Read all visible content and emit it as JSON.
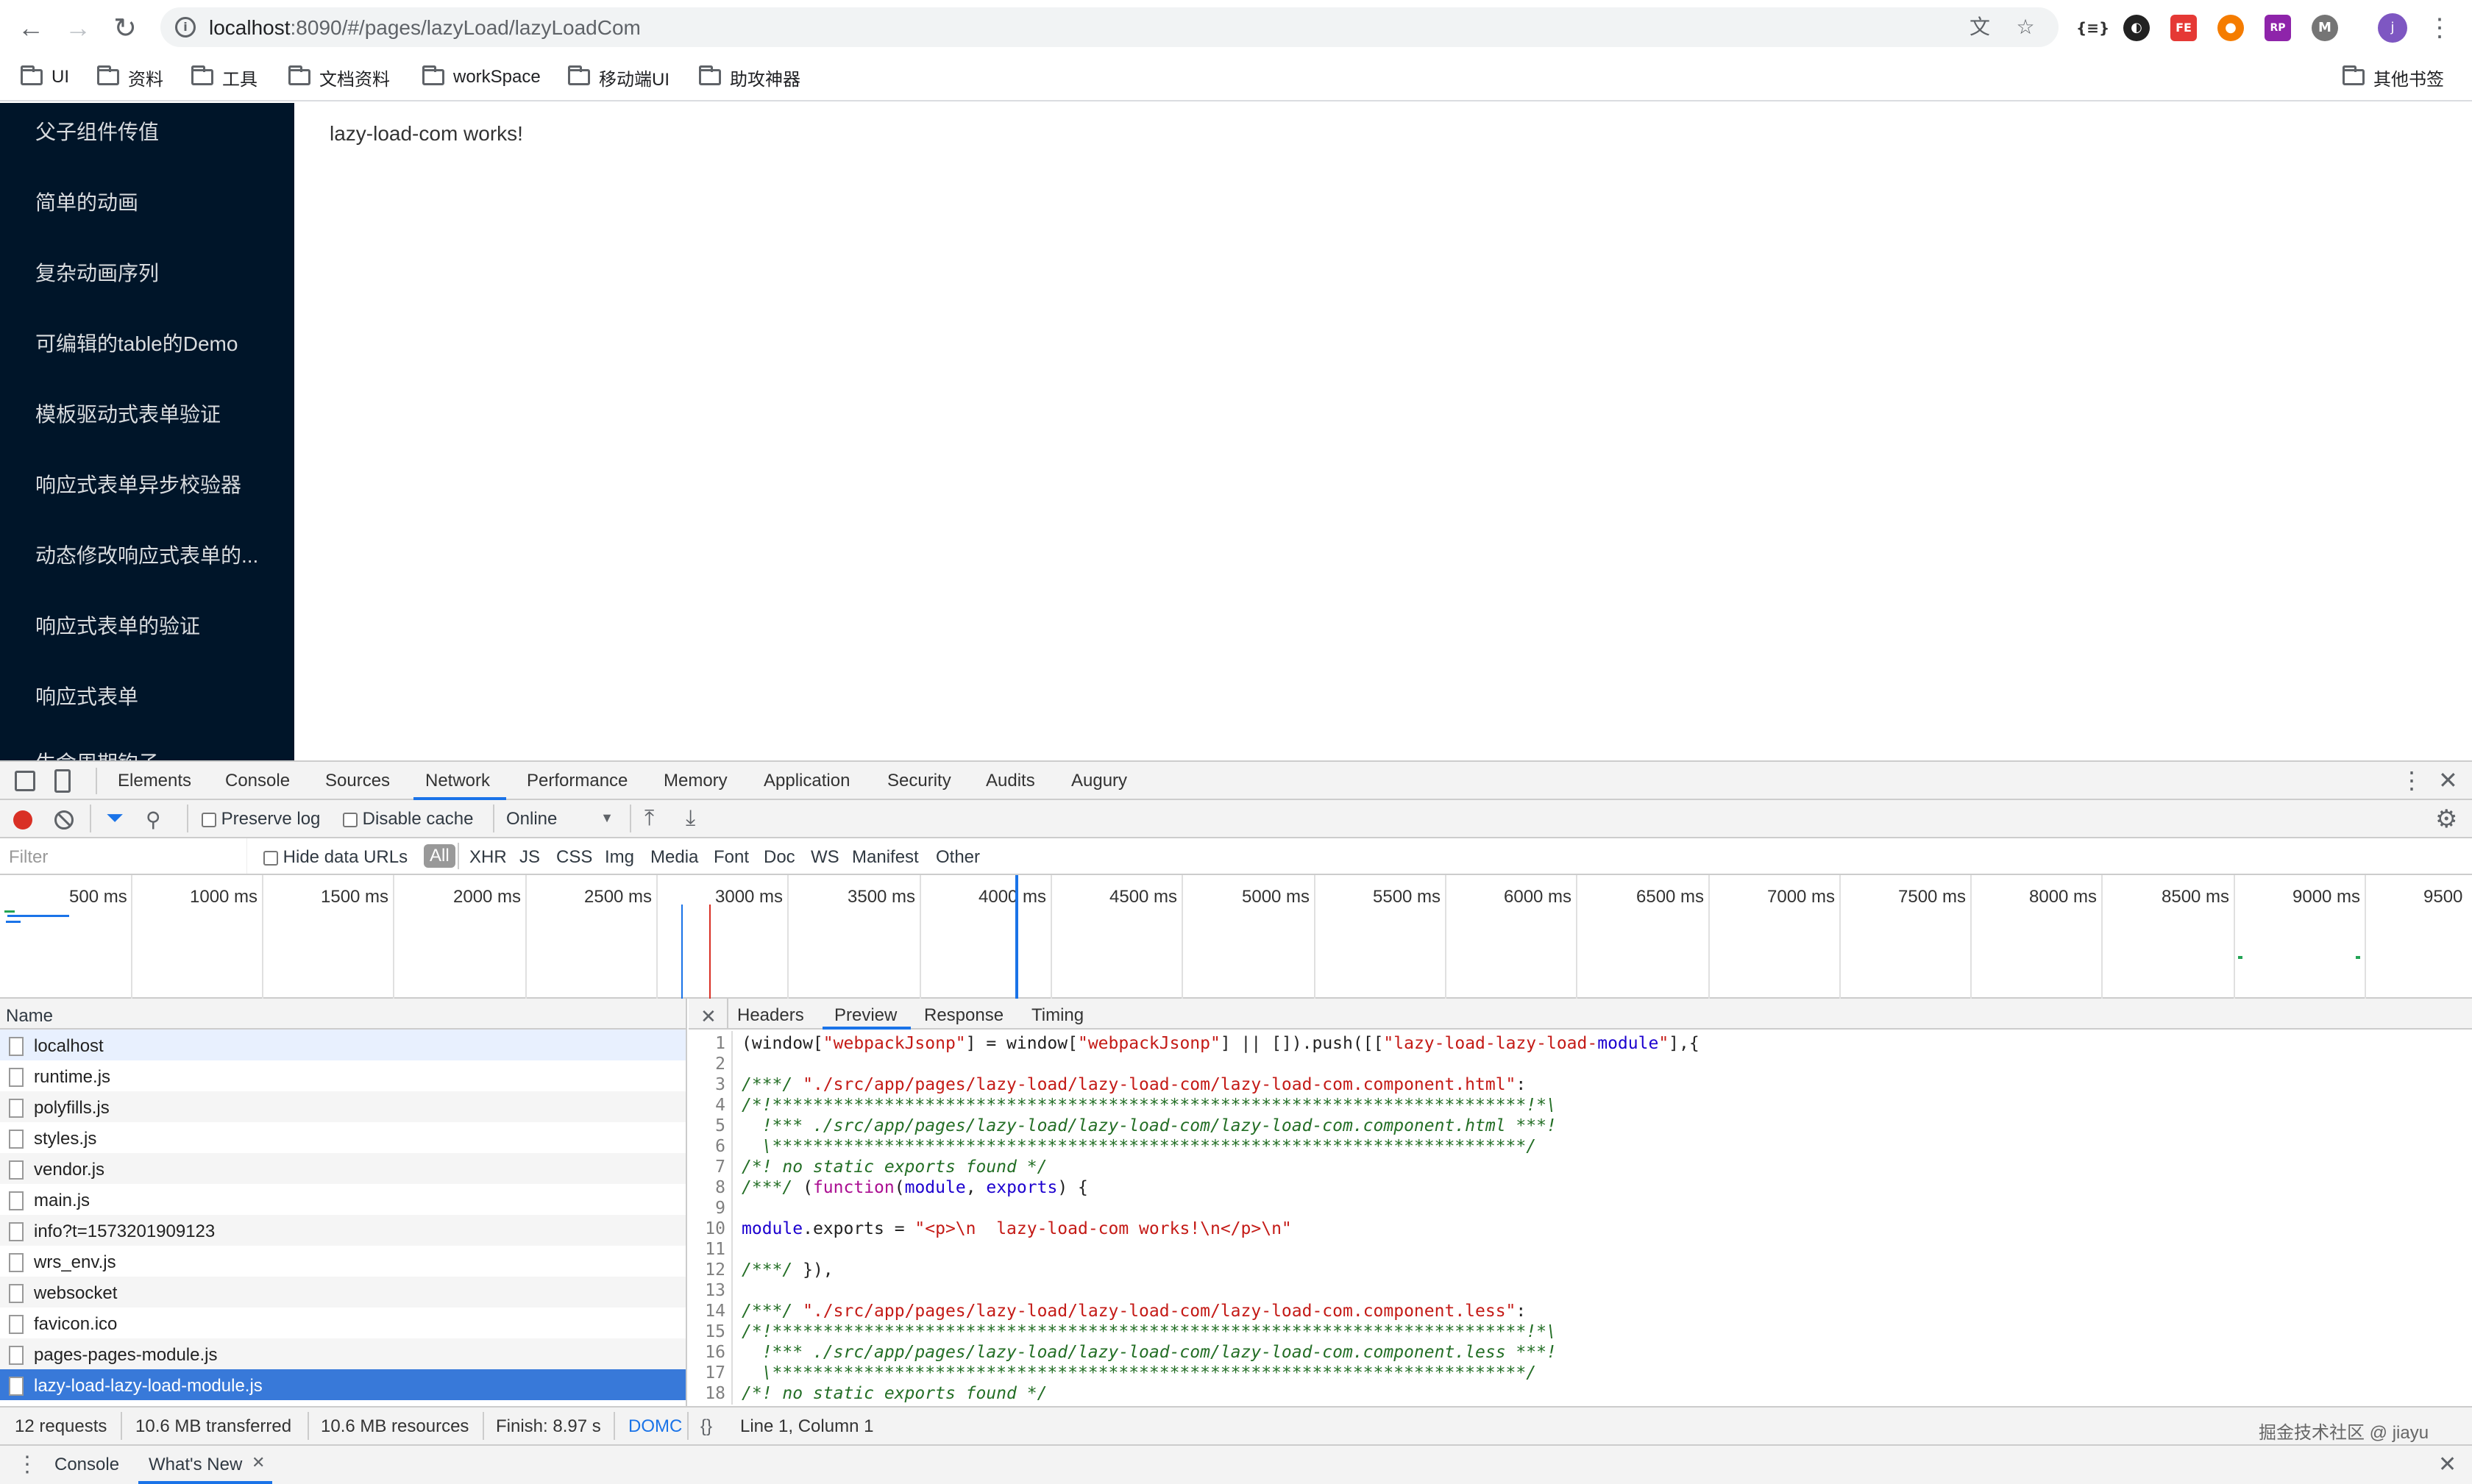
{
  "browser": {
    "url_host": "localhost",
    "url_rest": ":8090/#/pages/lazyLoad/lazyLoadCom",
    "avatar_letter": "j"
  },
  "bookmarks": [
    {
      "label": "UI"
    },
    {
      "label": "资料"
    },
    {
      "label": "工具"
    },
    {
      "label": "文档资料"
    },
    {
      "label": "workSpace"
    },
    {
      "label": "移动端UI"
    },
    {
      "label": "助攻神器"
    }
  ],
  "bookmarks_other": "其他书签",
  "sidebar": {
    "items": [
      "父子组件传值",
      "简单的动画",
      "复杂动画序列",
      "可编辑的table的Demo",
      "模板驱动式表单验证",
      "响应式表单异步校验器",
      "动态修改响应式表单的...",
      "响应式表单的验证",
      "响应式表单",
      "生命周期钩子"
    ]
  },
  "main": {
    "text": "lazy-load-com works!"
  },
  "devtools": {
    "tabs": [
      "Elements",
      "Console",
      "Sources",
      "Network",
      "Performance",
      "Memory",
      "Application",
      "Security",
      "Audits",
      "Augury"
    ],
    "active_tab": "Network",
    "toolbar": {
      "preserve_log": "Preserve log",
      "disable_cache": "Disable cache",
      "throttle": "Online"
    },
    "filter": {
      "placeholder": "Filter",
      "hide_data_urls": "Hide data URLs",
      "types": [
        "All",
        "XHR",
        "JS",
        "CSS",
        "Img",
        "Media",
        "Font",
        "Doc",
        "WS",
        "Manifest",
        "Other"
      ]
    },
    "timeline_labels": [
      "500 ms",
      "1000 ms",
      "1500 ms",
      "2000 ms",
      "2500 ms",
      "3000 ms",
      "3500 ms",
      "4000 ms",
      "4500 ms",
      "5000 ms",
      "5500 ms",
      "6000 ms",
      "6500 ms",
      "7000 ms",
      "7500 ms",
      "8000 ms",
      "8500 ms",
      "9000 ms",
      "9500"
    ],
    "requests_header": "Name",
    "requests": [
      "localhost",
      "runtime.js",
      "polyfills.js",
      "styles.js",
      "vendor.js",
      "main.js",
      "info?t=1573201909123",
      "wrs_env.js",
      "websocket",
      "favicon.ico",
      "pages-pages-module.js",
      "lazy-load-lazy-load-module.js"
    ],
    "selected_request": "lazy-load-lazy-load-module.js",
    "preview_tabs": [
      "Headers",
      "Preview",
      "Response",
      "Timing"
    ],
    "active_preview_tab": "Preview",
    "code_lines": [
      "(window[\"webpackJsonp\"] = window[\"webpackJsonp\"] || []).push([[\"lazy-load-lazy-load-module\"],{",
      "",
      "/***/ \"./src/app/pages/lazy-load/lazy-load-com/lazy-load-com.component.html\":",
      "/*!**************************************************************************!*\\",
      "  !*** ./src/app/pages/lazy-load/lazy-load-com/lazy-load-com.component.html ***!",
      "  \\**************************************************************************/",
      "/*! no static exports found */",
      "/***/ (function(module, exports) {",
      "",
      "module.exports = \"<p>\\n  lazy-load-com works!\\n</p>\\n\"",
      "",
      "/***/ }),",
      "",
      "/***/ \"./src/app/pages/lazy-load/lazy-load-com/lazy-load-com.component.less\":",
      "/*!**************************************************************************!*\\",
      "  !*** ./src/app/pages/lazy-load/lazy-load-com/lazy-load-com.component.less ***!",
      "  \\**************************************************************************/",
      "/*! no static exports found */"
    ],
    "status": {
      "requests": "12 requests",
      "transferred": "10.6 MB transferred",
      "resources": "10.6 MB resources",
      "finish": "Finish: 8.97 s",
      "domc": "DOMC",
      "cursor": "Line 1, Column 1"
    },
    "drawer_tabs": [
      "Console",
      "What's New"
    ],
    "watermark": "掘金技术社区 @ jiayu"
  },
  "colors": {
    "sidebar_bg": "#001529",
    "accent": "#1a73e8",
    "selected_row": "#3879d9"
  }
}
